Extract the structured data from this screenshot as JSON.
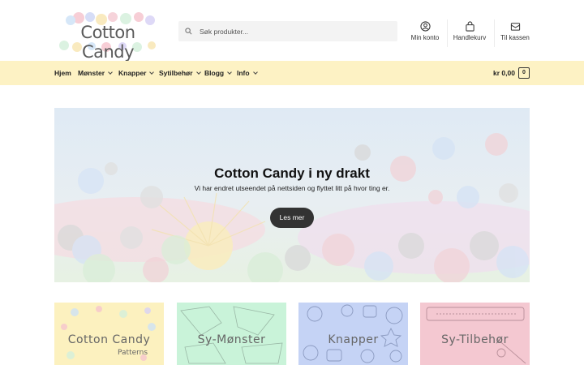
{
  "header": {
    "logo_text": "Cotton Candy",
    "search_placeholder": "Søk produkter...",
    "links": [
      {
        "label": "Min konto",
        "icon": "user-icon"
      },
      {
        "label": "Handlekurv",
        "icon": "bag-icon"
      },
      {
        "label": "Til kassen",
        "icon": "checkout-icon"
      }
    ]
  },
  "nav": {
    "items": [
      {
        "label": "Hjem",
        "has_dropdown": false
      },
      {
        "label": "Mønster",
        "has_dropdown": true
      },
      {
        "label": "Knapper",
        "has_dropdown": true
      },
      {
        "label": "Sytilbehør",
        "has_dropdown": true
      },
      {
        "label": "Blogg",
        "has_dropdown": true
      },
      {
        "label": "Info",
        "has_dropdown": true
      }
    ],
    "cart_total": "kr 0,00",
    "cart_count": "0"
  },
  "hero": {
    "title": "Cotton Candy i ny drakt",
    "subtitle": "Vi har endret utseendet på nettsiden og flyttet litt på hvor ting er.",
    "button_label": "Les mer"
  },
  "categories": [
    {
      "label": "Cotton Candy",
      "sublabel": "Patterns",
      "bg": "#fcf1bf"
    },
    {
      "label": "Sy-Mønster",
      "sublabel": "",
      "bg": "#c9f3d9"
    },
    {
      "label": "Knapper",
      "sublabel": "",
      "bg": "#c5d3f5"
    },
    {
      "label": "Sy-Tilbehør",
      "sublabel": "",
      "bg": "#f4c8d1"
    }
  ],
  "colors": {
    "nav_bg": "#fdf2c4",
    "button_bg": "#333333",
    "search_bg": "#f3f3f3"
  }
}
